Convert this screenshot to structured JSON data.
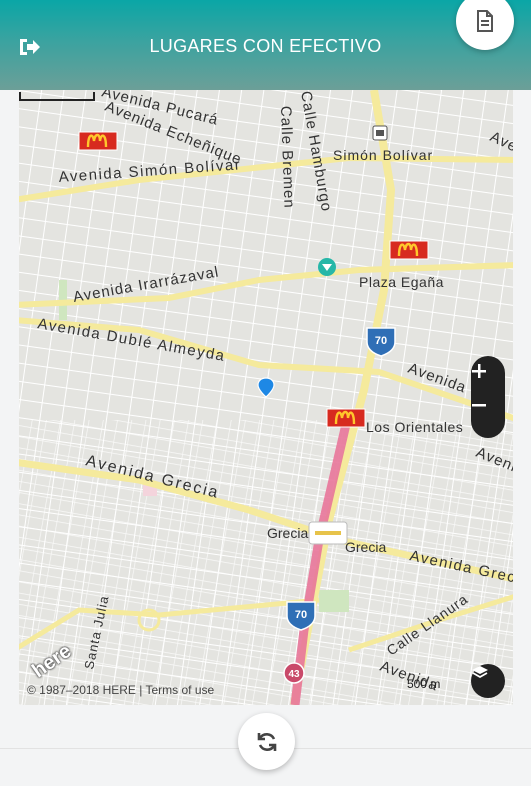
{
  "header": {
    "title": "LUGARES CON EFECTIVO",
    "logout_icon": "sign-out-icon",
    "document_icon": "document-icon"
  },
  "map": {
    "streets": {
      "pucara": "Avenida Pucará",
      "echenique": "Avenida Echeñique",
      "bolivar": "Avenida Simón Bolívar",
      "bolivar_short": "Simón Bolívar",
      "bremen": "Calle Bremen",
      "hamburgo": "Calle Hamburgo",
      "irarrazaval": "Avenida Irarrázaval",
      "duble": "Avenida Dublé Almeyda",
      "grecia": "Avenida Grecia",
      "grecia_east": "Avenida Grecia",
      "llanura": "Calle Llanura",
      "santa_julia": "Santa Julia",
      "avenida_e1": "Avenida",
      "avenida_e2": "Avenida",
      "avenida_se": "Avenida"
    },
    "places": {
      "plaza_egana": "Plaza Egaña",
      "los_orientales": "Los Orientales",
      "grecia_station_w": "Grecia",
      "grecia_station_e": "Grecia"
    },
    "route_shields": [
      "70",
      "70",
      "43"
    ],
    "attribution": "© 1987–2018 HERE | Terms of use",
    "brand": "here",
    "scale_label": "500 m",
    "poi_icons": [
      "mcdonalds-icon",
      "mcdonalds-icon",
      "mcdonalds-icon",
      "metro-icon",
      "bank-icon",
      "location-pin-icon"
    ]
  },
  "controls": {
    "zoom_in": "+",
    "zoom_out": "−",
    "layers_icon": "layers-icon",
    "refresh_icon": "refresh-icon"
  },
  "colors": {
    "accent": "#0aa6a6",
    "highway": "#f3e58a",
    "transit": "#e8769a",
    "mcdonalds_red": "#d72a1f",
    "mcdonalds_yellow": "#ffc72c",
    "pin": "#1e88e5"
  }
}
